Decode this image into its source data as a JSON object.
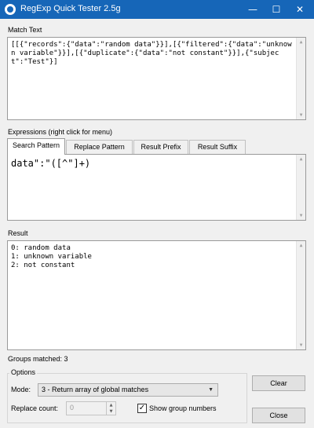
{
  "window": {
    "title": "RegExp Quick Tester 2.5g",
    "controls": {
      "minimize": "—",
      "maximize": "☐",
      "close": "✕"
    }
  },
  "match_text": {
    "label": "Match Text",
    "value": "[[{\"records\":{\"data\":\"random data\"}}],[{\"filtered\":{\"data\":\"unknown variable\"}}],[{\"duplicate\":{\"data\":\"not constant\"}}],{\"subject\":\"Test\"}]"
  },
  "expressions": {
    "label": "Expressions (right click for menu)",
    "tabs": [
      "Search Pattern",
      "Replace Pattern",
      "Result Prefix",
      "Result Suffix"
    ],
    "active_tab": "Search Pattern",
    "search_pattern": "data\":\"([^\"]+)"
  },
  "result": {
    "label": "Result",
    "value": "0: random data\n1: unknown variable\n2: not constant",
    "groups_matched": "Groups matched: 3"
  },
  "options": {
    "label": "Options",
    "mode_label": "Mode:",
    "mode_value": "3 - Return array of global matches",
    "replace_count_label": "Replace count:",
    "replace_count_value": "0",
    "show_group_numbers_label": "Show group numbers",
    "show_group_numbers_checked": true
  },
  "buttons": {
    "clear": "Clear",
    "close": "Close"
  },
  "icons": {
    "scroll_up": "▲",
    "scroll_down": "▼",
    "dropdown": "▼",
    "spin_up": "▲",
    "spin_down": "▼",
    "checkmark": "✓"
  },
  "colors": {
    "titlebar": "#1666b8",
    "window_bg": "#f0f0f0"
  }
}
